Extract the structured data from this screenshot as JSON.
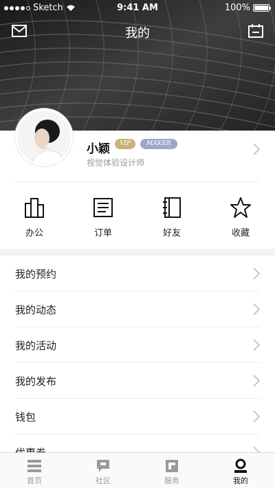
{
  "status_bar": {
    "carrier": "Sketch",
    "time": "9:41 AM",
    "battery": "100%"
  },
  "nav": {
    "title": "我的",
    "left_icon": "mail-icon",
    "right_icon": "calendar-edit-icon"
  },
  "profile": {
    "name": "小颖",
    "badges": [
      "VIP",
      "MAKER"
    ],
    "subtitle": "视觉体验设计师"
  },
  "actions": [
    {
      "label": "办公",
      "icon": "office-building-icon"
    },
    {
      "label": "订单",
      "icon": "order-list-icon"
    },
    {
      "label": "好友",
      "icon": "notebook-icon"
    },
    {
      "label": "收藏",
      "icon": "star-icon"
    }
  ],
  "menu": [
    {
      "label": "我的预约"
    },
    {
      "label": "我的动态"
    },
    {
      "label": "我的活动"
    },
    {
      "label": "我的发布"
    },
    {
      "label": "钱包"
    },
    {
      "label": "优惠券"
    }
  ],
  "tabs": [
    {
      "label": "首页",
      "icon": "home-icon",
      "active": false
    },
    {
      "label": "社区",
      "icon": "community-icon",
      "active": false
    },
    {
      "label": "服务",
      "icon": "service-icon",
      "active": false
    },
    {
      "label": "我的",
      "icon": "profile-icon",
      "active": true
    }
  ],
  "colors": {
    "vip_badge": "#c8b27a",
    "maker_badge": "#9fa6c9",
    "section_gap": "#f2f2f2",
    "divider": "#ececec"
  }
}
